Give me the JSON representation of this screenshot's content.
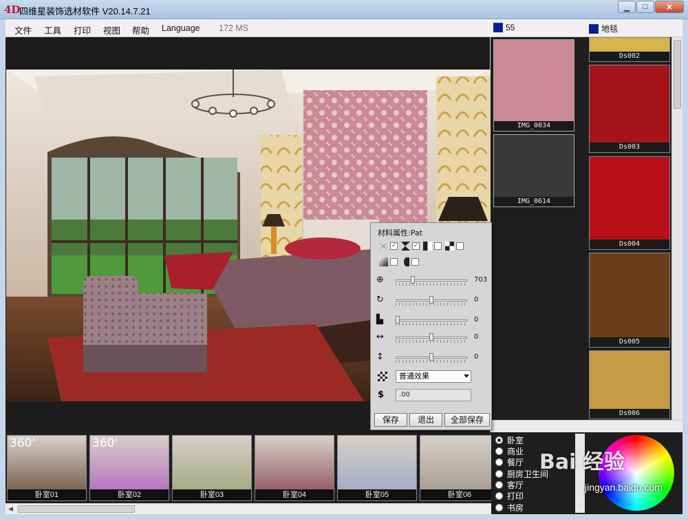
{
  "window": {
    "logo": "4D",
    "title": "四维星装饰选材软件 V20.14.7.21",
    "minimize_glyph": "▁",
    "maximize_glyph": "□",
    "close_glyph": "✕"
  },
  "menu": {
    "items": [
      "文件",
      "工具",
      "打印",
      "视图",
      "帮助",
      "Language"
    ],
    "status": "172 MS"
  },
  "panels": {
    "material_header": "55",
    "floor_header": "地毯"
  },
  "materials": [
    {
      "label": "IMG_0034",
      "color": "#c98a96"
    },
    {
      "label": "IMG_0614",
      "color": "#3a3838"
    }
  ],
  "floor_items": [
    {
      "label": "Ds002",
      "color": "#d9b44a"
    },
    {
      "label": "Ds003",
      "color": "#a5141b"
    },
    {
      "label": "Ds004",
      "color": "#b8101a"
    },
    {
      "label": "Ds005",
      "color": "#6a3f1a"
    },
    {
      "label": "Ds006",
      "color": "#c79a45"
    }
  ],
  "properties": {
    "title": "材料属性:Pat",
    "sliders": [
      {
        "icon": "zoom-icon",
        "glyph": "⊕",
        "value": "703",
        "level": 0.22
      },
      {
        "icon": "rotate-icon",
        "glyph": "↻",
        "value": "0",
        "level": 0.5
      },
      {
        "icon": "skew-icon",
        "glyph": "▙",
        "value": "0",
        "level": 0.0
      },
      {
        "icon": "horizontal-offset-icon",
        "glyph": "↔",
        "value": "0",
        "level": 0.5
      },
      {
        "icon": "vertical-offset-icon",
        "glyph": "↕",
        "value": "0",
        "level": 0.5
      }
    ],
    "effect_select": "普通效果",
    "price_value": ".00",
    "buttons": {
      "save": "保存",
      "exit": "退出",
      "save_all": "全部保存"
    }
  },
  "rooms": [
    {
      "label": "卧室01",
      "badge": "360'",
      "color": "#6a4e3a"
    },
    {
      "label": "卧室02",
      "badge": "360'",
      "color": "#b060c0"
    },
    {
      "label": "卧室03",
      "badge": "",
      "color": "#9aa57a"
    },
    {
      "label": "卧室04",
      "badge": "",
      "color": "#8a4a55"
    },
    {
      "label": "卧室05",
      "badge": "",
      "color": "#9aa6c4"
    },
    {
      "label": "卧室06",
      "badge": "",
      "color": "#a09486"
    }
  ],
  "room_types": [
    {
      "label": "卧室",
      "selected": true
    },
    {
      "label": "商业",
      "selected": false
    },
    {
      "label": "餐厅",
      "selected": false
    },
    {
      "label": "厨房卫生间",
      "selected": false
    },
    {
      "label": "客厅",
      "selected": false
    },
    {
      "label": "打印",
      "selected": false
    },
    {
      "label": "书房",
      "selected": false
    }
  ],
  "watermark": {
    "brand": "Bai  经验",
    "url": "jingyan.baidu.com"
  },
  "colors": {
    "accent": "#1f3fb8",
    "dark_bg": "#1e1e1e"
  }
}
